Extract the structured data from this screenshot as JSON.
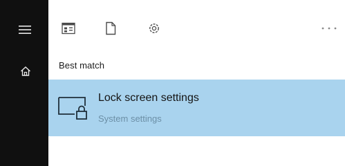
{
  "sidebar": {
    "menu_icon": "hamburger-menu-icon",
    "home_icon": "home-icon"
  },
  "toolbar": {
    "filters": [
      {
        "icon": "apps-icon",
        "name": "apps"
      },
      {
        "icon": "document-icon",
        "name": "documents"
      },
      {
        "icon": "gear-icon",
        "name": "settings"
      }
    ],
    "more_icon": "more-options-icon"
  },
  "results": {
    "section_title": "Best match",
    "best_match": {
      "icon": "lock-screen-icon",
      "title": "Lock screen settings",
      "subtitle": "System settings"
    }
  },
  "colors": {
    "rail_background": "#101010",
    "selected_background": "#a9d3ee",
    "subtitle_text": "#6c8fa6"
  }
}
